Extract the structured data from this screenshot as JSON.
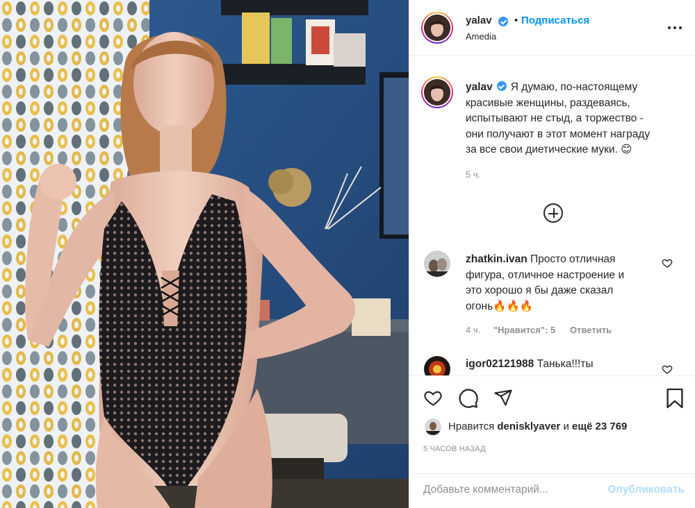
{
  "post": {
    "username": "yalav",
    "location": "Amedia",
    "follow_label": "Подписаться",
    "separator": "•"
  },
  "caption": {
    "username": "yalav",
    "lines": [
      "Я думаю, по-настоящему",
      "красивые женщины, раздеваясь,",
      "испытывают не стыд, а торжество -",
      "они получают в этот момент награду",
      "за все свои диетические муки. 😊"
    ],
    "time": "5 ч."
  },
  "comments": [
    {
      "username": "zhatkin.ivan",
      "lines": [
        "Просто отличная",
        "фигура, отличное настроение и",
        "это хорошо я бы даже сказал",
        "огонь🔥🔥🔥"
      ],
      "time": "4 ч.",
      "likes_label": "\"Нравится\": 5",
      "reply_label": "Ответить"
    },
    {
      "username": "igor02121988",
      "text": "Танька!!!ты"
    }
  ],
  "likes": {
    "prefix": "Нравится",
    "liker": "denisklyaver",
    "conjunction": "и",
    "rest": "ещё 23 769"
  },
  "time_ago": "5 ЧАСОВ НАЗАД",
  "composer": {
    "placeholder": "Добавьте комментарий...",
    "post_label": "Опубликовать"
  },
  "icons": {
    "more": "more-options-icon",
    "add": "load-more-comments-icon",
    "like": "heart-icon",
    "comment": "comment-icon",
    "share": "share-icon",
    "save": "bookmark-icon"
  },
  "colors": {
    "accent": "#0095f6",
    "verified": "#3897f0",
    "muted": "#8e8e8e",
    "post_disabled": "#b2dffc"
  }
}
